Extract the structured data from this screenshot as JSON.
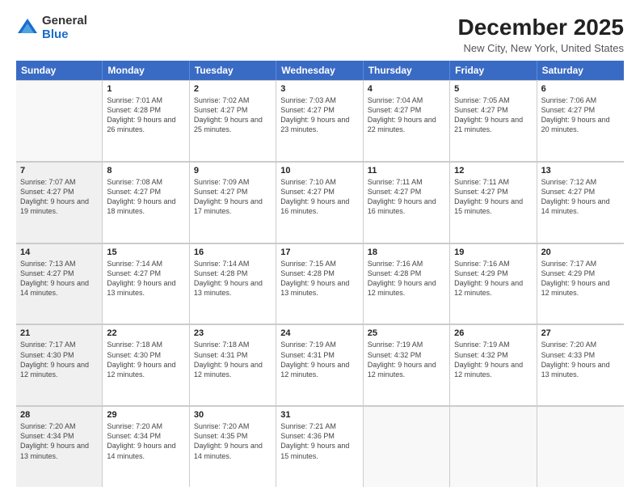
{
  "logo": {
    "general": "General",
    "blue": "Blue"
  },
  "title": "December 2025",
  "subtitle": "New City, New York, United States",
  "days": [
    "Sunday",
    "Monday",
    "Tuesday",
    "Wednesday",
    "Thursday",
    "Friday",
    "Saturday"
  ],
  "weeks": [
    [
      {
        "num": "",
        "sunrise": "",
        "sunset": "",
        "daylight": "",
        "empty": true
      },
      {
        "num": "1",
        "sunrise": "Sunrise: 7:01 AM",
        "sunset": "Sunset: 4:28 PM",
        "daylight": "Daylight: 9 hours and 26 minutes.",
        "empty": false
      },
      {
        "num": "2",
        "sunrise": "Sunrise: 7:02 AM",
        "sunset": "Sunset: 4:27 PM",
        "daylight": "Daylight: 9 hours and 25 minutes.",
        "empty": false
      },
      {
        "num": "3",
        "sunrise": "Sunrise: 7:03 AM",
        "sunset": "Sunset: 4:27 PM",
        "daylight": "Daylight: 9 hours and 23 minutes.",
        "empty": false
      },
      {
        "num": "4",
        "sunrise": "Sunrise: 7:04 AM",
        "sunset": "Sunset: 4:27 PM",
        "daylight": "Daylight: 9 hours and 22 minutes.",
        "empty": false
      },
      {
        "num": "5",
        "sunrise": "Sunrise: 7:05 AM",
        "sunset": "Sunset: 4:27 PM",
        "daylight": "Daylight: 9 hours and 21 minutes.",
        "empty": false
      },
      {
        "num": "6",
        "sunrise": "Sunrise: 7:06 AM",
        "sunset": "Sunset: 4:27 PM",
        "daylight": "Daylight: 9 hours and 20 minutes.",
        "empty": false
      }
    ],
    [
      {
        "num": "7",
        "sunrise": "Sunrise: 7:07 AM",
        "sunset": "Sunset: 4:27 PM",
        "daylight": "Daylight: 9 hours and 19 minutes.",
        "empty": false,
        "shaded": true
      },
      {
        "num": "8",
        "sunrise": "Sunrise: 7:08 AM",
        "sunset": "Sunset: 4:27 PM",
        "daylight": "Daylight: 9 hours and 18 minutes.",
        "empty": false
      },
      {
        "num": "9",
        "sunrise": "Sunrise: 7:09 AM",
        "sunset": "Sunset: 4:27 PM",
        "daylight": "Daylight: 9 hours and 17 minutes.",
        "empty": false
      },
      {
        "num": "10",
        "sunrise": "Sunrise: 7:10 AM",
        "sunset": "Sunset: 4:27 PM",
        "daylight": "Daylight: 9 hours and 16 minutes.",
        "empty": false
      },
      {
        "num": "11",
        "sunrise": "Sunrise: 7:11 AM",
        "sunset": "Sunset: 4:27 PM",
        "daylight": "Daylight: 9 hours and 16 minutes.",
        "empty": false
      },
      {
        "num": "12",
        "sunrise": "Sunrise: 7:11 AM",
        "sunset": "Sunset: 4:27 PM",
        "daylight": "Daylight: 9 hours and 15 minutes.",
        "empty": false
      },
      {
        "num": "13",
        "sunrise": "Sunrise: 7:12 AM",
        "sunset": "Sunset: 4:27 PM",
        "daylight": "Daylight: 9 hours and 14 minutes.",
        "empty": false
      }
    ],
    [
      {
        "num": "14",
        "sunrise": "Sunrise: 7:13 AM",
        "sunset": "Sunset: 4:27 PM",
        "daylight": "Daylight: 9 hours and 14 minutes.",
        "empty": false,
        "shaded": true
      },
      {
        "num": "15",
        "sunrise": "Sunrise: 7:14 AM",
        "sunset": "Sunset: 4:27 PM",
        "daylight": "Daylight: 9 hours and 13 minutes.",
        "empty": false
      },
      {
        "num": "16",
        "sunrise": "Sunrise: 7:14 AM",
        "sunset": "Sunset: 4:28 PM",
        "daylight": "Daylight: 9 hours and 13 minutes.",
        "empty": false
      },
      {
        "num": "17",
        "sunrise": "Sunrise: 7:15 AM",
        "sunset": "Sunset: 4:28 PM",
        "daylight": "Daylight: 9 hours and 13 minutes.",
        "empty": false
      },
      {
        "num": "18",
        "sunrise": "Sunrise: 7:16 AM",
        "sunset": "Sunset: 4:28 PM",
        "daylight": "Daylight: 9 hours and 12 minutes.",
        "empty": false
      },
      {
        "num": "19",
        "sunrise": "Sunrise: 7:16 AM",
        "sunset": "Sunset: 4:29 PM",
        "daylight": "Daylight: 9 hours and 12 minutes.",
        "empty": false
      },
      {
        "num": "20",
        "sunrise": "Sunrise: 7:17 AM",
        "sunset": "Sunset: 4:29 PM",
        "daylight": "Daylight: 9 hours and 12 minutes.",
        "empty": false
      }
    ],
    [
      {
        "num": "21",
        "sunrise": "Sunrise: 7:17 AM",
        "sunset": "Sunset: 4:30 PM",
        "daylight": "Daylight: 9 hours and 12 minutes.",
        "empty": false,
        "shaded": true
      },
      {
        "num": "22",
        "sunrise": "Sunrise: 7:18 AM",
        "sunset": "Sunset: 4:30 PM",
        "daylight": "Daylight: 9 hours and 12 minutes.",
        "empty": false
      },
      {
        "num": "23",
        "sunrise": "Sunrise: 7:18 AM",
        "sunset": "Sunset: 4:31 PM",
        "daylight": "Daylight: 9 hours and 12 minutes.",
        "empty": false
      },
      {
        "num": "24",
        "sunrise": "Sunrise: 7:19 AM",
        "sunset": "Sunset: 4:31 PM",
        "daylight": "Daylight: 9 hours and 12 minutes.",
        "empty": false
      },
      {
        "num": "25",
        "sunrise": "Sunrise: 7:19 AM",
        "sunset": "Sunset: 4:32 PM",
        "daylight": "Daylight: 9 hours and 12 minutes.",
        "empty": false
      },
      {
        "num": "26",
        "sunrise": "Sunrise: 7:19 AM",
        "sunset": "Sunset: 4:32 PM",
        "daylight": "Daylight: 9 hours and 12 minutes.",
        "empty": false
      },
      {
        "num": "27",
        "sunrise": "Sunrise: 7:20 AM",
        "sunset": "Sunset: 4:33 PM",
        "daylight": "Daylight: 9 hours and 13 minutes.",
        "empty": false
      }
    ],
    [
      {
        "num": "28",
        "sunrise": "Sunrise: 7:20 AM",
        "sunset": "Sunset: 4:34 PM",
        "daylight": "Daylight: 9 hours and 13 minutes.",
        "empty": false,
        "shaded": true
      },
      {
        "num": "29",
        "sunrise": "Sunrise: 7:20 AM",
        "sunset": "Sunset: 4:34 PM",
        "daylight": "Daylight: 9 hours and 14 minutes.",
        "empty": false
      },
      {
        "num": "30",
        "sunrise": "Sunrise: 7:20 AM",
        "sunset": "Sunset: 4:35 PM",
        "daylight": "Daylight: 9 hours and 14 minutes.",
        "empty": false
      },
      {
        "num": "31",
        "sunrise": "Sunrise: 7:21 AM",
        "sunset": "Sunset: 4:36 PM",
        "daylight": "Daylight: 9 hours and 15 minutes.",
        "empty": false
      },
      {
        "num": "",
        "sunrise": "",
        "sunset": "",
        "daylight": "",
        "empty": true
      },
      {
        "num": "",
        "sunrise": "",
        "sunset": "",
        "daylight": "",
        "empty": true
      },
      {
        "num": "",
        "sunrise": "",
        "sunset": "",
        "daylight": "",
        "empty": true
      }
    ]
  ]
}
